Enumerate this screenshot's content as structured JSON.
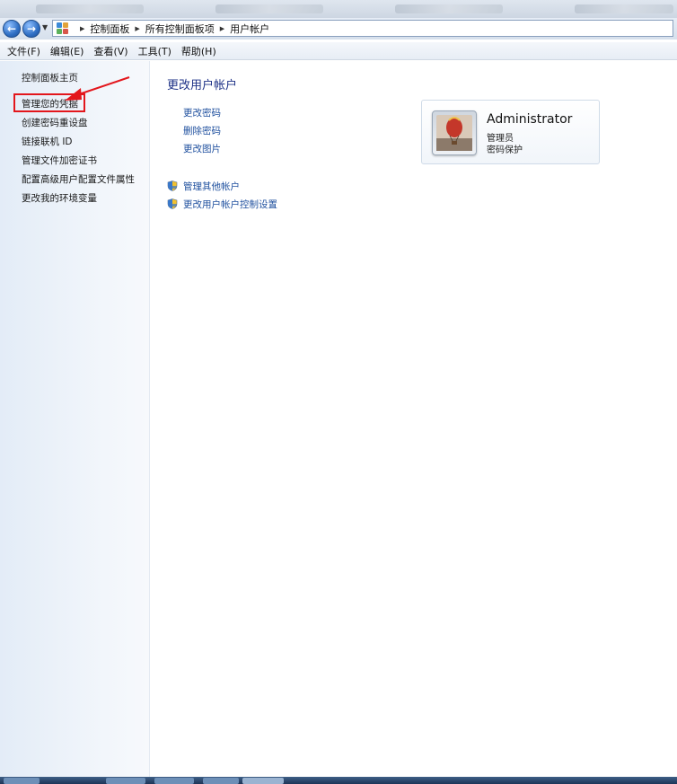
{
  "breadcrumbs": [
    "控制面板",
    "所有控制面板项",
    "用户帐户"
  ],
  "menu": [
    "文件(F)",
    "编辑(E)",
    "查看(V)",
    "工具(T)",
    "帮助(H)"
  ],
  "sidebar": {
    "items": [
      {
        "label": "控制面板主页"
      },
      {
        "label": "管理您的凭据"
      },
      {
        "label": "创建密码重设盘"
      },
      {
        "label": "链接联机 ID"
      },
      {
        "label": "管理文件加密证书"
      },
      {
        "label": "配置高级用户配置文件属性"
      },
      {
        "label": "更改我的环境变量"
      }
    ]
  },
  "main": {
    "title": "更改用户帐户",
    "tasks": [
      "更改密码",
      "删除密码",
      "更改图片"
    ],
    "shield_tasks": [
      "管理其他帐户",
      "更改用户帐户控制设置"
    ]
  },
  "account": {
    "name": "Administrator",
    "role": "管理员",
    "protection": "密码保护"
  },
  "colors": {
    "link": "#1e4f9e",
    "title": "#1e3287",
    "highlight": "#e3161c"
  },
  "icons": {
    "back": "back-arrow-icon",
    "forward": "forward-arrow-icon",
    "control_panel": "control-panel-icon",
    "shield": "uac-shield-icon",
    "avatar": "hot-air-balloon-icon"
  }
}
